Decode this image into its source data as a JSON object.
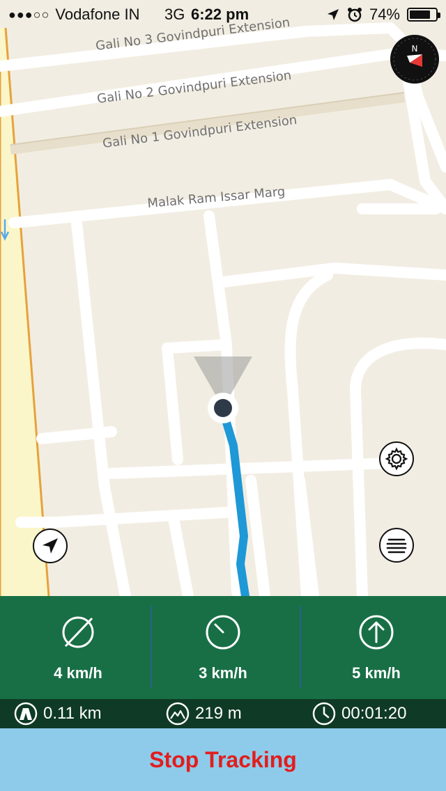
{
  "status_bar": {
    "signal_dots": "●●●○○",
    "carrier": "Vodafone IN",
    "network": "3G",
    "time": "6:22 pm",
    "battery": "74%",
    "icons": [
      "location-arrow-icon",
      "alarm-icon",
      "battery-icon"
    ]
  },
  "map": {
    "streets": [
      "Gali No 3 Govindpuri Extension",
      "Gali No 2 Govindpuri Extension",
      "Gali No 1 Govindpuri Extension",
      "Malak Ram Issar Marg"
    ],
    "compass_letter": "N",
    "colors": {
      "route": "#1e98d6",
      "highway": "#fbf6c9",
      "highway_edge": "#e6a23b",
      "block": "#f3ede2",
      "road": "#ffffff"
    }
  },
  "controls": {
    "locate_icon": "navigation-arrow-icon",
    "settings_icon": "gear-icon",
    "menu_icon": "menu-list-icon",
    "compass_icon": "compass-icon"
  },
  "stats": [
    {
      "icon": "average-speed-icon",
      "value": "4 km/h"
    },
    {
      "icon": "current-speed-icon",
      "value": "3 km/h"
    },
    {
      "icon": "max-speed-icon",
      "value": "5 km/h"
    }
  ],
  "info": {
    "distance": "0.11 km",
    "altitude": "219 m",
    "duration": "00:01:20"
  },
  "stop_label": "Stop Tracking",
  "panel_colors": {
    "stats_bg": "#186f46",
    "info_bg": "#0f3a25",
    "stop_bg": "#8ecbea",
    "stop_text": "#e11d1d"
  }
}
